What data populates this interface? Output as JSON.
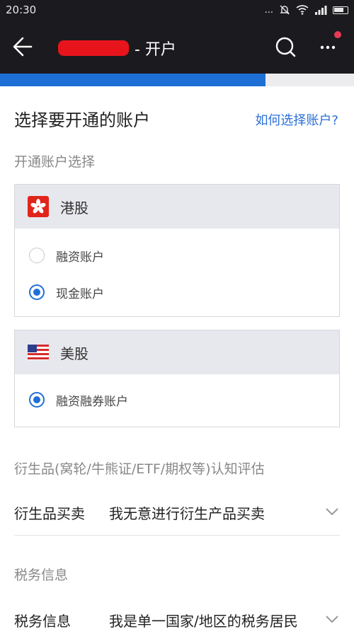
{
  "status_bar": {
    "time": "20:30",
    "signal": "...",
    "icons": [
      "muted-bell-icon",
      "wifi-icon",
      "signal-icon",
      "battery-icon"
    ]
  },
  "app_bar": {
    "title_suffix": "- 开户",
    "icons": [
      "back-arrow-icon",
      "search-icon",
      "more-icon"
    ],
    "notification_dot": true
  },
  "tabs": {
    "active_progress": 0.75
  },
  "account_section": {
    "title": "选择要开通的账户",
    "help_link": "如何选择账户?",
    "subtitle": "开通账户选择"
  },
  "markets": [
    {
      "name": "港股",
      "icon": "hong-kong-flag-icon",
      "options": [
        {
          "label": "融资账户",
          "selected": false
        },
        {
          "label": "现金账户",
          "selected": true
        }
      ]
    },
    {
      "name": "美股",
      "icon": "us-flag-icon",
      "options": [
        {
          "label": "融资融券账户",
          "selected": true
        }
      ]
    }
  ],
  "derivatives": {
    "section_label": "衍生品(窝轮/牛熊证/ETF/期权等)认知评估",
    "row_key": "衍生品买卖",
    "row_value": "我无意进行衍生产品买卖"
  },
  "tax": {
    "section_label": "税务信息",
    "row_key": "税务信息",
    "row_value": "我是单一国家/地区的税务居民"
  },
  "colors": {
    "accent": "#1f6fd6",
    "appbar": "#1b1b1f",
    "card_header": "#e7e7ee",
    "link": "#2a6fd8"
  }
}
